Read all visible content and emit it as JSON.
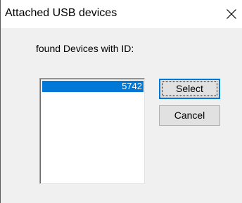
{
  "window": {
    "title": "Attached USB devices",
    "close_icon": "close-icon"
  },
  "dialog": {
    "heading": "found Devices with ID:",
    "devices": [
      "5742"
    ],
    "selected_index": 0,
    "select_label": "Select",
    "cancel_label": "Cancel"
  },
  "colors": {
    "selection": "#0078d7",
    "button_face": "#e1e1e1",
    "dialog_background": "#f0f0f0"
  }
}
